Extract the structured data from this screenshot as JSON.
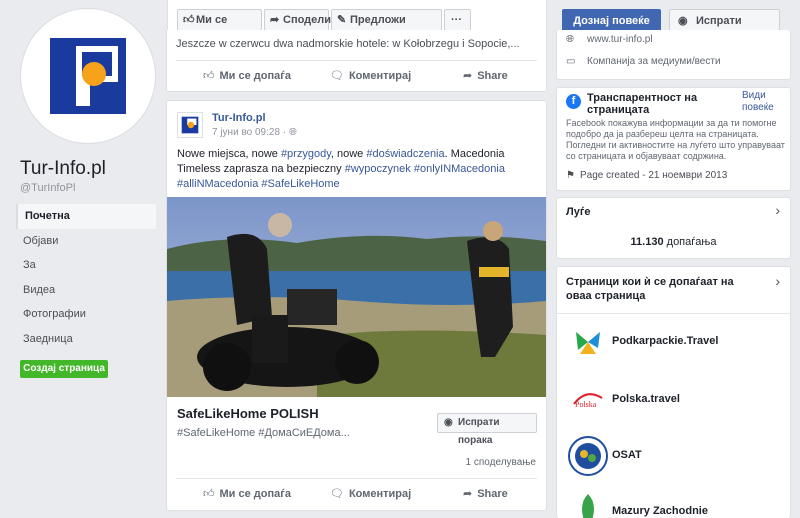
{
  "page": {
    "name": "Tur-Info.pl",
    "handle": "@TurInfoPl"
  },
  "nav": {
    "items": [
      "Почетна",
      "Објави",
      "За",
      "Видеа",
      "Фотографии",
      "Заедница"
    ],
    "create_label": "Создај страница"
  },
  "toolbar": {
    "like_label": "Ми се допаѓа",
    "share_label": "Сподели",
    "suggest_label": "Предложи измени",
    "more_label": "···"
  },
  "header": {
    "learn_more": "Дознај повеќе",
    "send_message": "Испрати порака"
  },
  "post1": {
    "snippet": "Jeszcze w czerwcu dwa nadmorskie hotele: w Kołobrzegu i Sopocie,...",
    "like": "Ми се допаѓа",
    "comment": "Коментирај",
    "share": "Share"
  },
  "post2": {
    "author": "Tur-Info.pl",
    "time": "7 јуни во 09:28 · ",
    "text_p1": "Nowe miejsca, nowe ",
    "tag1": "#przygody",
    "text_p2": ", nowe ",
    "tag2": "#doświadczenia",
    "text_p3": ". Macedonia Timeless zaprasza na bezpieczny ",
    "tag3": "#wypoczynek",
    "tag4": "#onlyINMacedonia",
    "tag5": "#alliNMacedonia",
    "tag6": "#SafeLikeHome",
    "shared_title": "SafeLikeHome POLISH",
    "shared_tags": "#SafeLikeHome #ДомаСиЕДома...",
    "send_message": "Испрати порака",
    "shares": "1 споделување",
    "like": "Ми се допаѓа",
    "comment": "Коментирај",
    "share": "Share"
  },
  "right": {
    "website": "www.tur-info.pl",
    "category": "Компанија за медиуми/вести",
    "transparency_title": "Транспарентност на страницата",
    "see_more": "Види повеќе",
    "transparency_desc": "Facebook покажува информации за да ти помогне подобро да ја разбереш целта на страницата. Погледни ги активностите на луѓето што управуваат со страницата и објавуваат содржина.",
    "created": "Page created - 21 ноември 2013",
    "people_title": "Луѓе",
    "likes_number": "11.130",
    "likes_suffix": " допаѓања",
    "liked_pages_title": "Страници кои ѝ се допаѓаат на оваа страница",
    "liked_pages": [
      "Podkarpackie.Travel",
      "Polska.travel",
      "OSAT",
      "Mazury Zachodnie"
    ]
  },
  "colors": {
    "brand_blue": "#1a3a9e",
    "logo_orange": "#f7a21b",
    "fb_blue": "#4267b2",
    "green": "#42b72a"
  }
}
